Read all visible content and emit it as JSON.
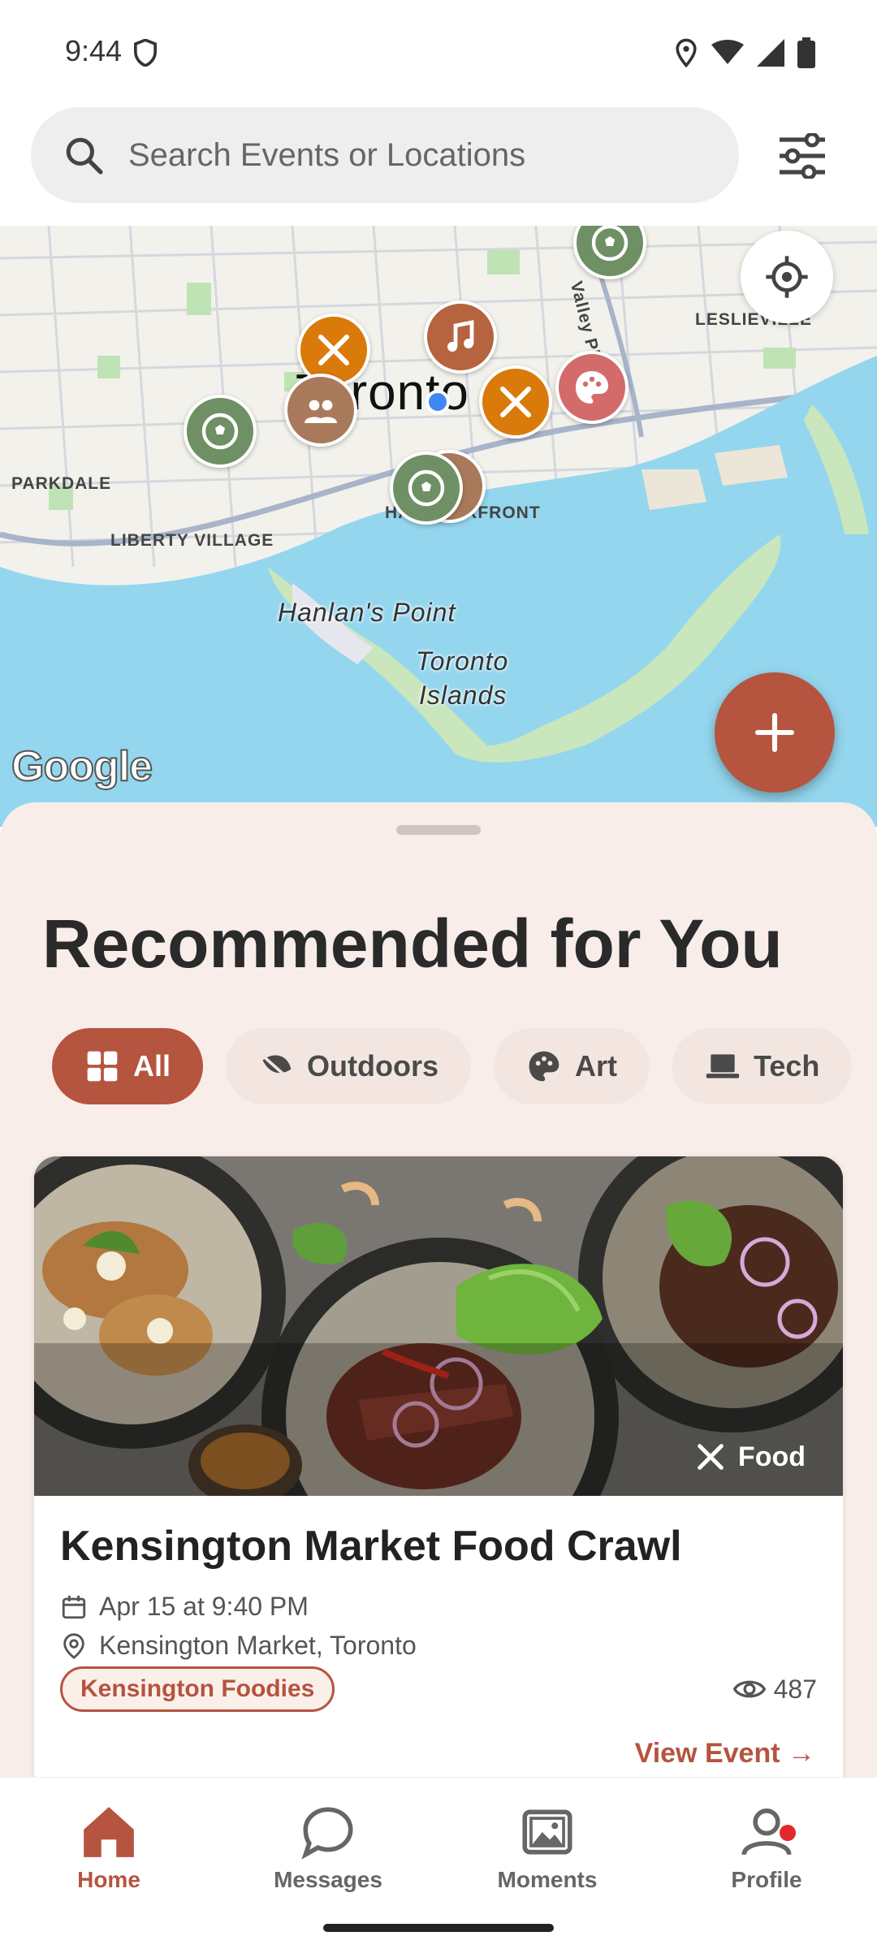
{
  "status_bar": {
    "time": "9:44"
  },
  "search": {
    "placeholder": "Search Events or Locations"
  },
  "map": {
    "labels": {
      "city": "Toronto",
      "leslieville": "LESLIEVILLE",
      "parkdale": "PARKDALE",
      "liberty_village": "LIBERTY VILLAGE",
      "harbourfront": "HARBOURFRONT",
      "hanlans_point": "Hanlan's Point",
      "toronto_islands_1": "Toronto",
      "toronto_islands_2": "Islands",
      "valley_pkwy": "Valley Pkwy"
    },
    "attribution": "Google"
  },
  "colors": {
    "accent": "#b5543f",
    "food_pin": "#d97a0a",
    "sport_pin": "#6f8f64",
    "music_pin": "#b6633f",
    "art_pin": "#d46b6b",
    "social_pin": "#a87a5b",
    "water": "#94d6ee"
  },
  "section": {
    "title": "Recommended for You"
  },
  "chips": [
    {
      "label": "All",
      "icon": "grid-icon",
      "active": true
    },
    {
      "label": "Outdoors",
      "icon": "leaf-icon",
      "active": false
    },
    {
      "label": "Art",
      "icon": "palette-icon",
      "active": false
    },
    {
      "label": "Tech",
      "icon": "laptop-icon",
      "active": false
    }
  ],
  "event_card": {
    "category": "Food",
    "title": "Kensington Market Food Crawl",
    "date": "Apr 15 at 9:40 PM",
    "location": "Kensington Market, Toronto",
    "organizer": "Kensington Foodies",
    "views": "487",
    "cta": "View Event →"
  },
  "nav": [
    {
      "label": "Home",
      "icon": "home-icon",
      "active": true
    },
    {
      "label": "Messages",
      "icon": "chat-icon",
      "active": false
    },
    {
      "label": "Moments",
      "icon": "image-icon",
      "active": false
    },
    {
      "label": "Profile",
      "icon": "person-icon",
      "active": false,
      "notification": true
    }
  ]
}
